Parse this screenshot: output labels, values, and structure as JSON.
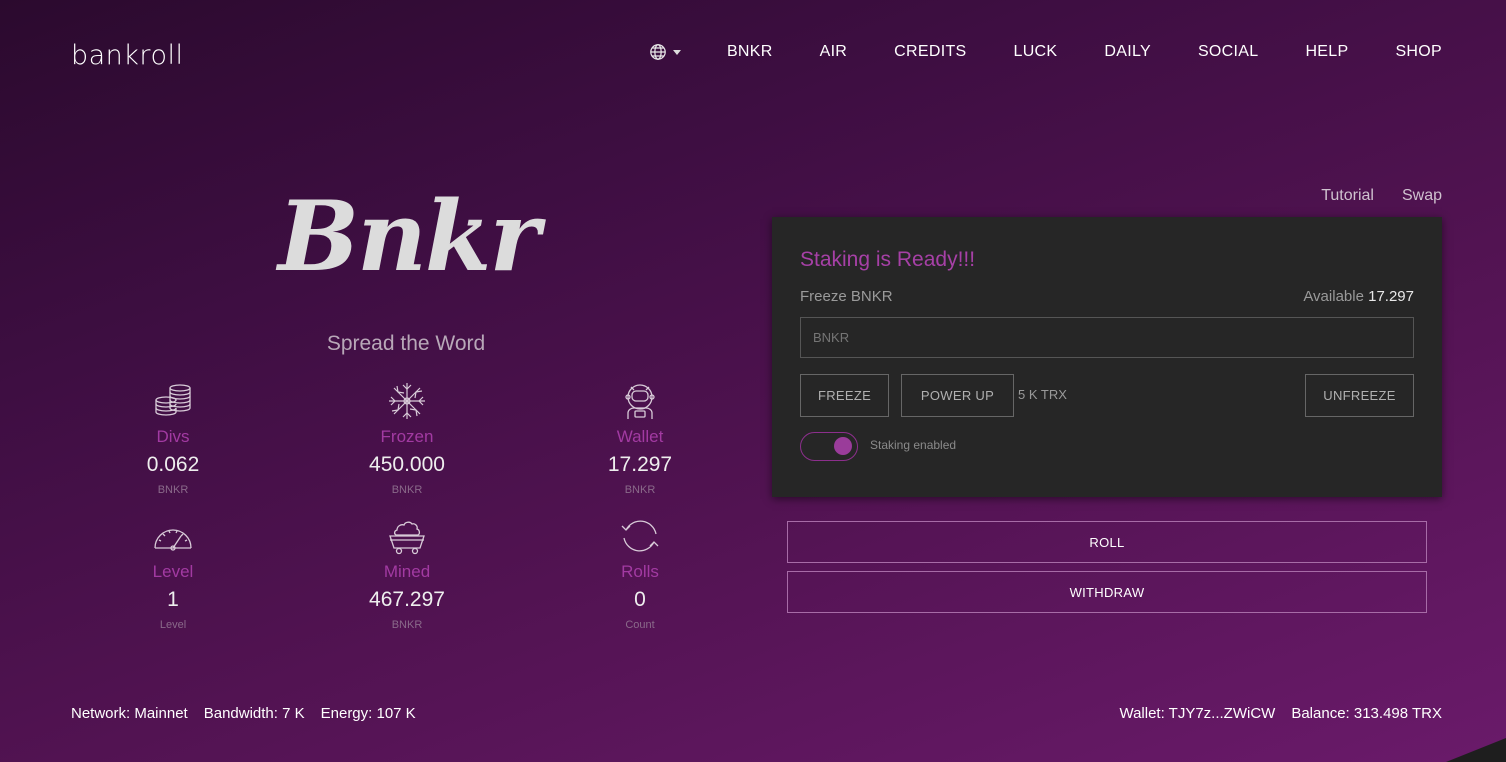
{
  "header": {
    "logo": "bankroll",
    "nav": [
      "BNKR",
      "AIR",
      "CREDITS",
      "LUCK",
      "DAILY",
      "SOCIAL",
      "HELP",
      "SHOP"
    ]
  },
  "hero": {
    "title": "Bnkr",
    "tagline": "Spread the Word"
  },
  "stats": [
    {
      "icon": "coins-stack-icon",
      "label": "Divs",
      "value": "0.062",
      "unit": "BNKR"
    },
    {
      "icon": "snowflake-icon",
      "label": "Frozen",
      "value": "450.000",
      "unit": "BNKR"
    },
    {
      "icon": "astronaut-icon",
      "label": "Wallet",
      "value": "17.297",
      "unit": "BNKR"
    },
    {
      "icon": "speedometer-icon",
      "label": "Level",
      "value": "1",
      "unit": "Level"
    },
    {
      "icon": "mine-cart-icon",
      "label": "Mined",
      "value": "467.297",
      "unit": "BNKR"
    },
    {
      "icon": "refresh-icon",
      "label": "Rolls",
      "value": "0",
      "unit": "Count"
    }
  ],
  "links": {
    "tutorial": "Tutorial",
    "swap": "Swap"
  },
  "staking": {
    "heading": "Staking is Ready!!!",
    "freeze_label": "Freeze BNKR",
    "available_label": "Available",
    "available_value": "17.297",
    "input_placeholder": "BNKR",
    "freeze_button": "FREEZE",
    "powerup_button": "POWER UP",
    "trx_cost": "5 K TRX",
    "unfreeze_button": "UNFREEZE",
    "toggle_on": true,
    "toggle_label": "Staking enabled"
  },
  "actions": {
    "roll": "ROLL",
    "withdraw": "WITHDRAW"
  },
  "footer": {
    "network": "Network: Mainnet",
    "bandwidth": "Bandwidth: 7 K",
    "energy": "Energy: 107 K",
    "wallet": "Wallet: TJY7z...ZWiCW",
    "balance": "Balance: 313.498 TRX"
  },
  "colors": {
    "accent": "#a23aa2",
    "panel_bg": "#262626"
  }
}
